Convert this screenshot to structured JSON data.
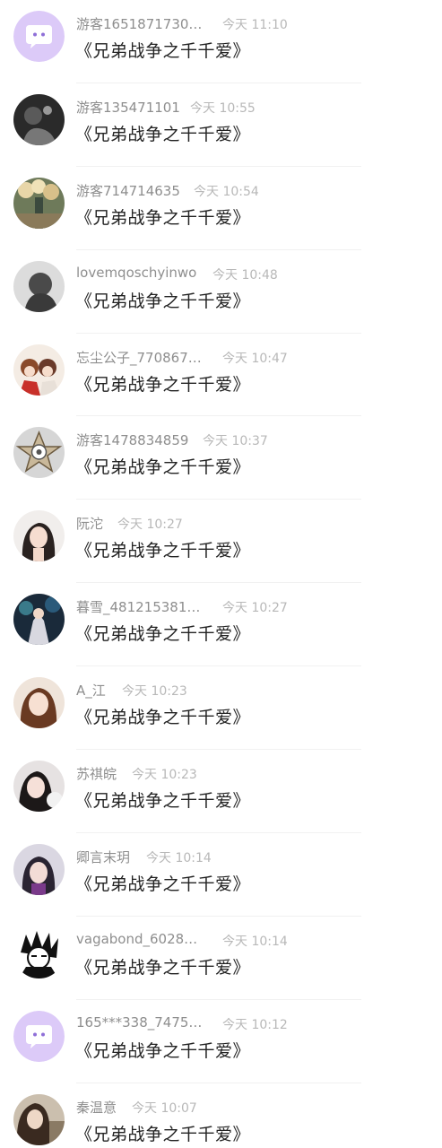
{
  "messages": [
    {
      "name": "游客1651871730…",
      "time": "今天 11:10",
      "title": "《兄弟战争之千千爱》",
      "avatar": "default-chat-avatar"
    },
    {
      "name": "游客135471101",
      "time": "今天 10:55",
      "title": "《兄弟战争之千千爱》",
      "avatar": "user-photo-avatar"
    },
    {
      "name": "游客714714635",
      "time": "今天 10:54",
      "title": "《兄弟战争之千千爱》",
      "avatar": "user-photo-avatar"
    },
    {
      "name": "lovemqoschyinwo",
      "time": "今天 10:48",
      "title": "《兄弟战争之千千爱》",
      "avatar": "user-photo-avatar"
    },
    {
      "name": "忘尘公子_770867…",
      "time": "今天 10:47",
      "title": "《兄弟战争之千千爱》",
      "avatar": "user-photo-avatar"
    },
    {
      "name": "游客1478834859",
      "time": "今天 10:37",
      "title": "《兄弟战争之千千爱》",
      "avatar": "user-photo-avatar"
    },
    {
      "name": "阮沱",
      "time": "今天 10:27",
      "title": "《兄弟战争之千千爱》",
      "avatar": "user-photo-avatar"
    },
    {
      "name": "暮雪_481215381…",
      "time": "今天 10:27",
      "title": "《兄弟战争之千千爱》",
      "avatar": "user-photo-avatar"
    },
    {
      "name": "A_江",
      "time": "今天 10:23",
      "title": "《兄弟战争之千千爱》",
      "avatar": "user-photo-avatar"
    },
    {
      "name": "苏祺皖",
      "time": "今天 10:23",
      "title": "《兄弟战争之千千爱》",
      "avatar": "user-photo-avatar"
    },
    {
      "name": "卿言末玥",
      "time": "今天 10:14",
      "title": "《兄弟战争之千千爱》",
      "avatar": "user-photo-avatar"
    },
    {
      "name": "vagabond_6028…",
      "time": "今天 10:14",
      "title": "《兄弟战争之千千爱》",
      "avatar": "user-photo-avatar"
    },
    {
      "name": "165***338_7475…",
      "time": "今天 10:12",
      "title": "《兄弟战争之千千爱》",
      "avatar": "default-chat-avatar"
    },
    {
      "name": "秦温意",
      "time": "今天 10:07",
      "title": "《兄弟战争之千千爱》",
      "avatar": "user-photo-avatar"
    }
  ],
  "colors": {
    "name_text": "#8e8e8e",
    "time_text": "#b8b8b8",
    "title_text": "#222222",
    "default_avatar_bg": "#d9c6f7",
    "default_avatar_accent": "#8f6fd8"
  }
}
